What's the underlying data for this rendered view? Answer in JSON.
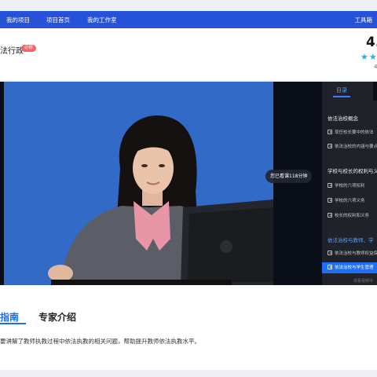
{
  "nav": {
    "my_projects": "我的项目",
    "project_home": "项目首页",
    "my_studio": "我的工作室",
    "toolbox": "工具箱"
  },
  "course": {
    "title": "法行政",
    "badge": "必修",
    "rating": "4.",
    "rating_digit": "4",
    "stars": "★★"
  },
  "player": {
    "watch_time": "您已看课118分钟"
  },
  "catalog": {
    "tab_label": "目录",
    "hint": "观看视频中",
    "sections": [
      {
        "title": "依法治校概念",
        "lessons": [
          "现任校长要中的依法",
          "依法治校的内涵与要点"
        ]
      },
      {
        "title": "学校与校长的权利与义",
        "lessons": [
          "学校的六项权利",
          "学校的六项义务",
          "校长的权利和义务"
        ]
      },
      {
        "title": "依法治校与教师、学",
        "lessons": [
          "依法治校与教师权益保",
          "依法治校与学生管理"
        ]
      }
    ]
  },
  "tabs": {
    "guide": "指南",
    "expert": "专家介绍"
  },
  "description": "要讲解了教师执教过程中依法执教的相关问题，帮助提升教师依法执教水平。",
  "colors": {
    "nav_blue": "#2652d9",
    "accent_blue": "#1d6df2",
    "badge_red": "#f36464",
    "star_blue": "#2bb0e6",
    "video_bg": "#2f66c4"
  }
}
